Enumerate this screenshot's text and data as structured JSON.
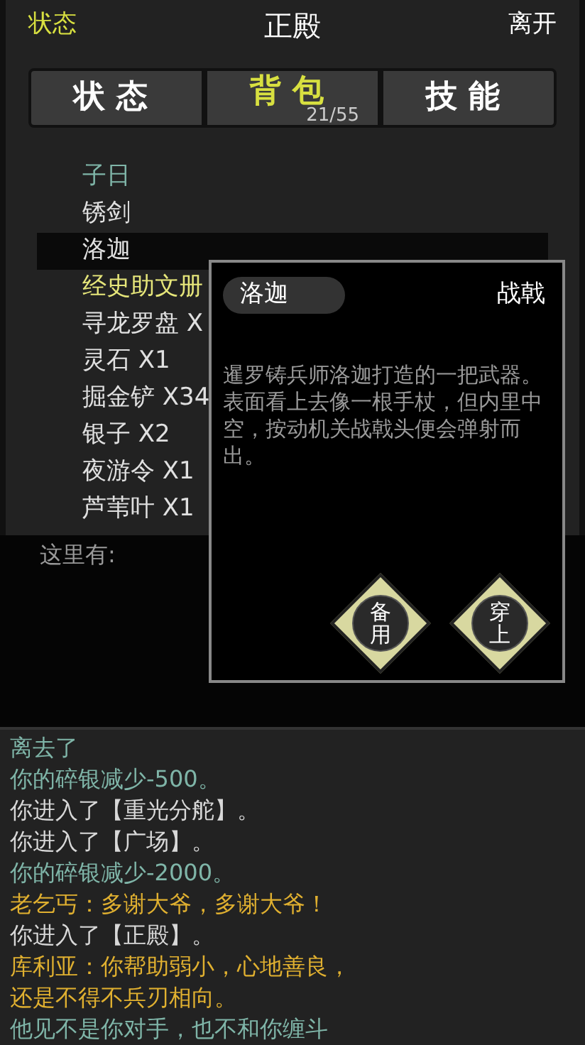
{
  "header": {
    "left": "状态",
    "title": "正殿",
    "right": "离开"
  },
  "tabs": [
    {
      "label": "状态",
      "selected": false
    },
    {
      "label": "背包",
      "selected": true,
      "count": "21/55"
    },
    {
      "label": "技能",
      "selected": false
    }
  ],
  "items": [
    {
      "name": "子日",
      "color": "#7fb5a8",
      "selected": false
    },
    {
      "name": "锈剑",
      "color": "#e0e0e0",
      "selected": false
    },
    {
      "name": "洛迦",
      "color": "#e0e0e0",
      "selected": true
    },
    {
      "name": "经史助文册",
      "color": "#e6e67a",
      "selected": false
    },
    {
      "name": "寻龙罗盘 X",
      "color": "#e0e0e0",
      "selected": false
    },
    {
      "name": "灵石 X1",
      "color": "#e0e0e0",
      "selected": false
    },
    {
      "name": "掘金铲 X34",
      "color": "#e0e0e0",
      "selected": false
    },
    {
      "name": "银子 X2",
      "color": "#e0e0e0",
      "selected": false
    },
    {
      "name": "夜游令 X1",
      "color": "#e0e0e0",
      "selected": false
    },
    {
      "name": "芦苇叶 X1",
      "color": "#e0e0e0",
      "selected": false
    }
  ],
  "here_label": "这里有:",
  "detail": {
    "name": "洛迦",
    "type": "战戟",
    "description": "暹罗铸兵师洛迦打造的一把武器。表面看上去像一根手杖，但内里中空，按动机关战戟头便会弹射而出。",
    "buttons": [
      "备用",
      "穿上"
    ]
  },
  "log": [
    {
      "text": "离去了",
      "color": "#7fb5a8"
    },
    {
      "text": "你的碎银减少-500。",
      "color": "#7fb5a8"
    },
    {
      "text": "你进入了【重光分舵】。",
      "color": "#d8d8d8"
    },
    {
      "text": "你进入了【广场】。",
      "color": "#d8d8d8"
    },
    {
      "text": "你的碎银减少-2000。",
      "color": "#7fb5a8"
    },
    {
      "text": "老乞丐：多谢大爷，多谢大爷！",
      "color": "#e0b030"
    },
    {
      "text": "你进入了【正殿】。",
      "color": "#d8d8d8"
    },
    {
      "text": "库利亚：你帮助弱小，心地善良，还是不得不兵刃相向。",
      "color": "#e0b030"
    },
    {
      "text": "他见不是你对手，也不和你缠斗",
      "color": "#7fb5a8"
    }
  ]
}
